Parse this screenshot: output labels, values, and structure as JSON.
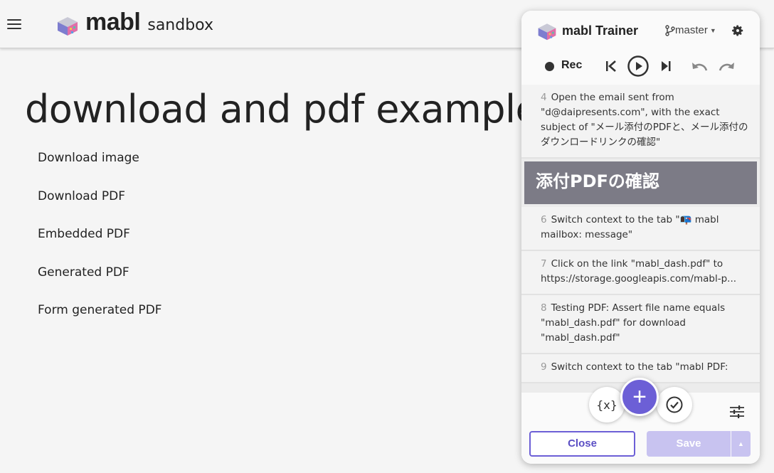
{
  "header": {
    "brand": "mabl",
    "subtitle": "sandbox"
  },
  "main": {
    "title": "download and pdf examples",
    "links": [
      "Download image",
      "Download PDF",
      "Embedded PDF",
      "Generated PDF",
      "Form generated PDF"
    ]
  },
  "trainer": {
    "title": "mabl Trainer",
    "branch": "master",
    "rec_label": "Rec",
    "steps": [
      {
        "num": "4",
        "text": "Open the email sent from \"d@daipresents.com\", with the exact subject of \"メール添付のPDFと、メール添付のダウンロードリンクの確認\""
      },
      {
        "section": "添付PDFの確認"
      },
      {
        "num": "6",
        "text": "Switch context to the tab \"📭 mabl mailbox: message\""
      },
      {
        "num": "7",
        "text": "Click on the link \"mabl_dash.pdf\" to https://storage.googleapis.com/mabl-p..."
      },
      {
        "num": "8",
        "text": "Testing PDF: Assert file name equals \"mabl_dash.pdf\" for download \"mabl_dash.pdf\""
      },
      {
        "num": "9",
        "text": "Switch context to the tab \"mabl PDF:"
      }
    ],
    "var_label": "{x}",
    "add_label": "+",
    "close_label": "Close",
    "save_label": "Save"
  },
  "colors": {
    "accent": "#6c5fd6",
    "section_bg": "#7c7b86",
    "save_disabled": "#c8c3f0"
  }
}
